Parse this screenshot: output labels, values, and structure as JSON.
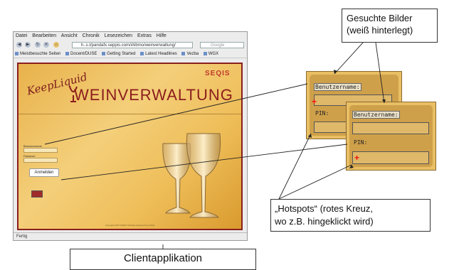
{
  "browser": {
    "menu": [
      "Datei",
      "Bearbeiten",
      "Ansicht",
      "Chronik",
      "Lesezeichen",
      "Extras",
      "Hilfe"
    ],
    "url": "h..s.t/pandafx.seppis.com/iAlbmo/weinverwaltung/",
    "search_placeholder": "Google",
    "bookmarks": [
      "Meistbesuchte Seiten",
      "Docent/DUSE",
      "Getting Started",
      "Latest Headlines",
      "Vezba",
      "WGX"
    ],
    "status": "Fertig"
  },
  "app": {
    "logo_script": "KeepLiquid",
    "brand": "SEQIS",
    "title": "WEINVERWALTUNG",
    "login": {
      "user_label": "Benutzername",
      "password_label": "Passwort",
      "button": "Anmelden"
    },
    "copyright": "Copyright 2007 SEQIS Software Engineering GmbH"
  },
  "zoom": {
    "panel1": {
      "user_label": "Benutzername:",
      "pin_label": "PIN:",
      "hotspot": "+"
    },
    "panel2": {
      "user_label": "Benutzername:",
      "pin_label": "PIN:",
      "hotspot": "+"
    }
  },
  "callouts": {
    "top_line1": "Gesuchte Bilder",
    "top_line2": "(weiß hinterlegt)",
    "hotspot_line1": "„Hotspots“ (rotes Kreuz,",
    "hotspot_line2": "wo z.B. hingeklickt wird)",
    "client": "Clientapplikation"
  },
  "colors": {
    "accent": "#8b1d1d",
    "hotspot": "#e11111",
    "panel": "#e9bf64"
  }
}
